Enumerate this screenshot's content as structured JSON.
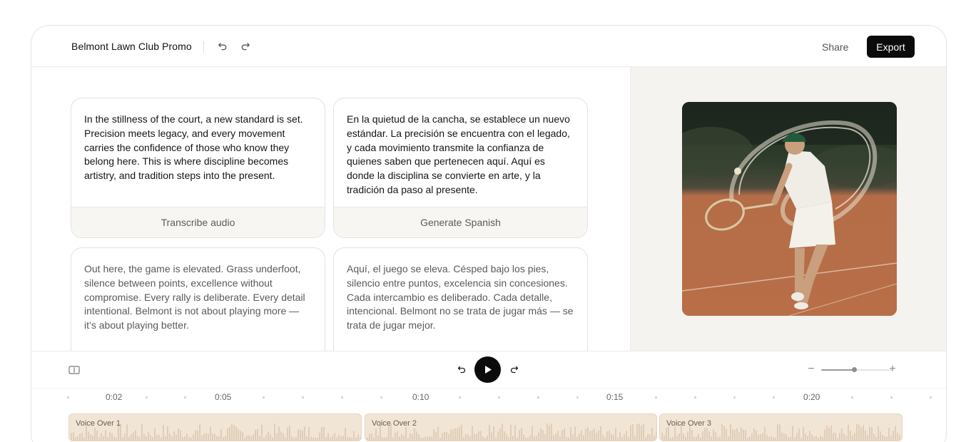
{
  "header": {
    "title": "Belmont Lawn Club Promo",
    "share_label": "Share",
    "export_label": "Export"
  },
  "cards": {
    "english_1": {
      "text": "In the stillness of the court, a new standard is set. Precision meets legacy, and every movement carries the confidence of those who know they belong here. This is where discipline becomes artistry, and tradition steps into the present.",
      "action_label": "Transcribe audio"
    },
    "spanish_1": {
      "text": "En la quietud de la cancha, se establece un nuevo estándar. La precisión se encuentra con el legado, y cada movimiento transmite la confianza de quienes saben que pertenecen aquí. Aquí es donde la disciplina se convierte en arte, y la tradición da paso al presente.",
      "action_label": "Generate Spanish"
    },
    "english_2": {
      "text": "Out here, the game is elevated. Grass underfoot, silence between points, excellence without compromise. Every rally is deliberate. Every detail intentional. Belmont is not about playing more — it’s about playing better."
    },
    "spanish_2": {
      "text": "Aquí, el juego se eleva. Césped bajo los pies, silencio entre puntos, excelencia sin concesiones. Cada intercambio es deliberado. Cada detalle, intencional. Belmont no se trata de jugar más — se trata de jugar mejor."
    }
  },
  "transport": {
    "zoom_out_label": "−",
    "zoom_in_label": "+",
    "zoom_level": 0.47
  },
  "ruler": {
    "labels": [
      "0:02",
      "0:05",
      "0:10",
      "0:15",
      "0:20"
    ]
  },
  "track": {
    "clips": [
      {
        "label": "Voice Over 1"
      },
      {
        "label": "Voice Over 2"
      },
      {
        "label": "Voice Over 3"
      }
    ]
  },
  "icons": {
    "undo": "undo-icon",
    "redo": "redo-icon",
    "split": "split-clip-icon",
    "skip_back": "skip-back-icon",
    "play": "play-icon",
    "skip_forward": "skip-forward-icon"
  },
  "colors": {
    "accent": "#0b0b0b",
    "clip_fill": "#f1e5d6",
    "panel_bg": "#f4f3f0"
  }
}
